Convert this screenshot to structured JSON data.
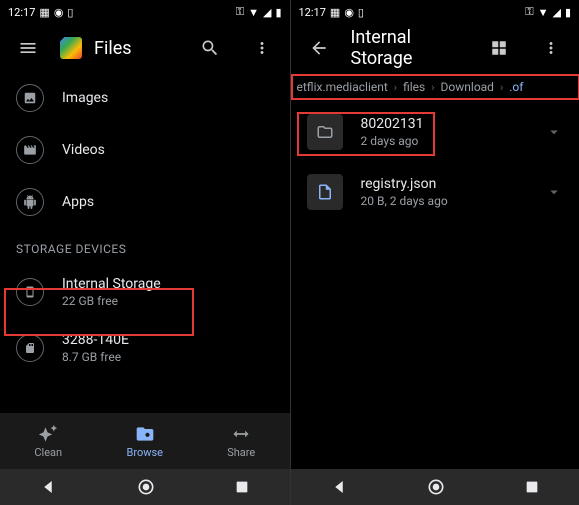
{
  "status": {
    "time": "12:17"
  },
  "left": {
    "app_title": "Files",
    "categories": [
      {
        "label": "Images"
      },
      {
        "label": "Videos"
      },
      {
        "label": "Apps"
      }
    ],
    "storage_header": "STORAGE DEVICES",
    "storage": [
      {
        "name": "Internal Storage",
        "sub": "22 GB free"
      },
      {
        "name": "3288-140E",
        "sub": "8.7 GB free"
      }
    ],
    "nav": {
      "clean": "Clean",
      "browse": "Browse",
      "share": "Share"
    }
  },
  "right": {
    "app_title": "Internal Storage",
    "breadcrumb": [
      "etflix.mediaclient",
      "files",
      "Download",
      ".of"
    ],
    "items": [
      {
        "name": "80202131",
        "sub": "2 days ago",
        "type": "folder"
      },
      {
        "name": "registry.json",
        "sub": "20 B, 2 days ago",
        "type": "file"
      }
    ]
  }
}
